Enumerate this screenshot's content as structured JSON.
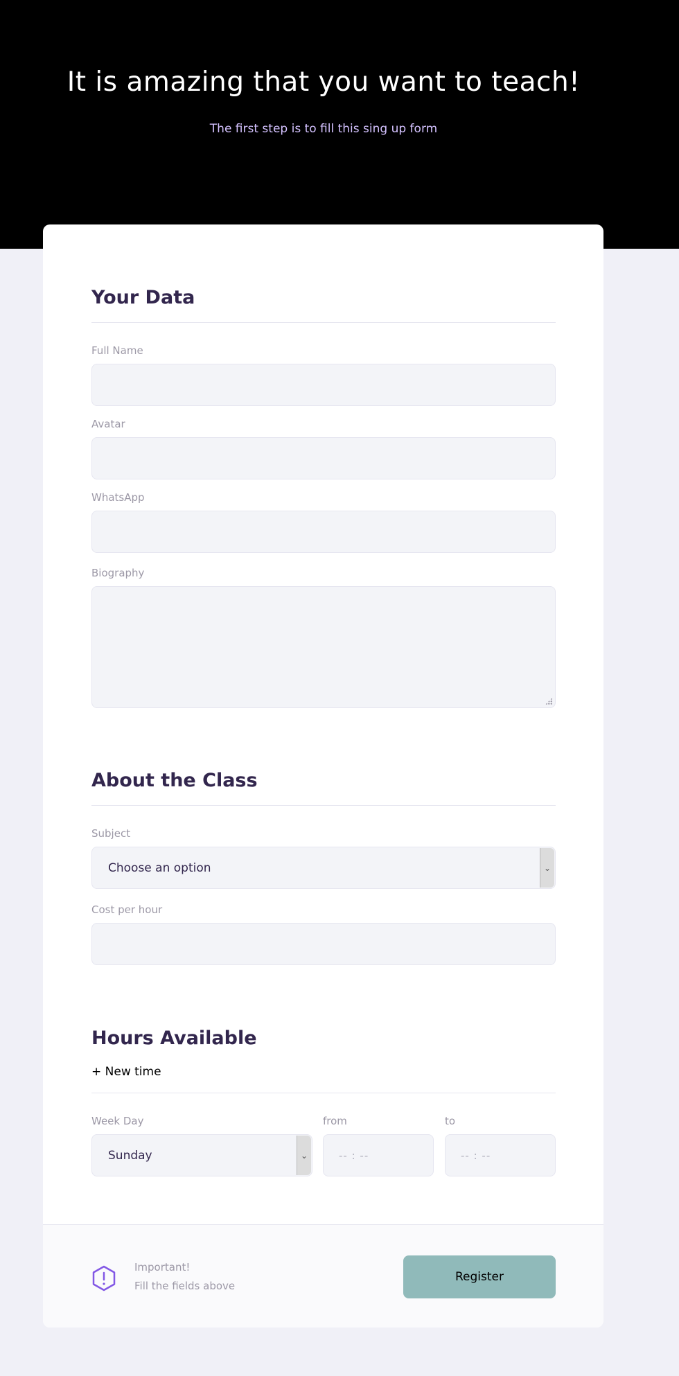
{
  "header": {
    "title": "It is amazing that you want to teach!",
    "subtitle": "The first step is to fill this sing up form"
  },
  "your_data": {
    "title": "Your Data",
    "fields": {
      "full_name": {
        "label": "Full Name",
        "value": ""
      },
      "avatar": {
        "label": "Avatar",
        "value": ""
      },
      "whatsapp": {
        "label": "WhatsApp",
        "value": ""
      },
      "biography": {
        "label": "Biography",
        "value": ""
      }
    }
  },
  "about_class": {
    "title": "About the Class",
    "subject": {
      "label": "Subject",
      "selected": "Choose an option"
    },
    "cost": {
      "label": "Cost per hour",
      "value": ""
    }
  },
  "hours": {
    "title": "Hours Available",
    "new_time": "+ New time",
    "week_day": {
      "label": "Week Day",
      "selected": "Sunday"
    },
    "from": {
      "label": "from",
      "placeholder": "-- : --"
    },
    "to": {
      "label": "to",
      "placeholder": "-- : --"
    }
  },
  "footer": {
    "important": "Important!",
    "note": "Fill the fields above",
    "register_label": "Register",
    "icon": "warning-hexagon-icon"
  },
  "colors": {
    "hero_bg": "#000000",
    "page_bg": "#f0f0f7",
    "section_title": "#32264d",
    "label": "#9c98a6",
    "input_bg": "#f3f4f8",
    "button": "#90baba",
    "icon_accent": "#8257e5"
  }
}
